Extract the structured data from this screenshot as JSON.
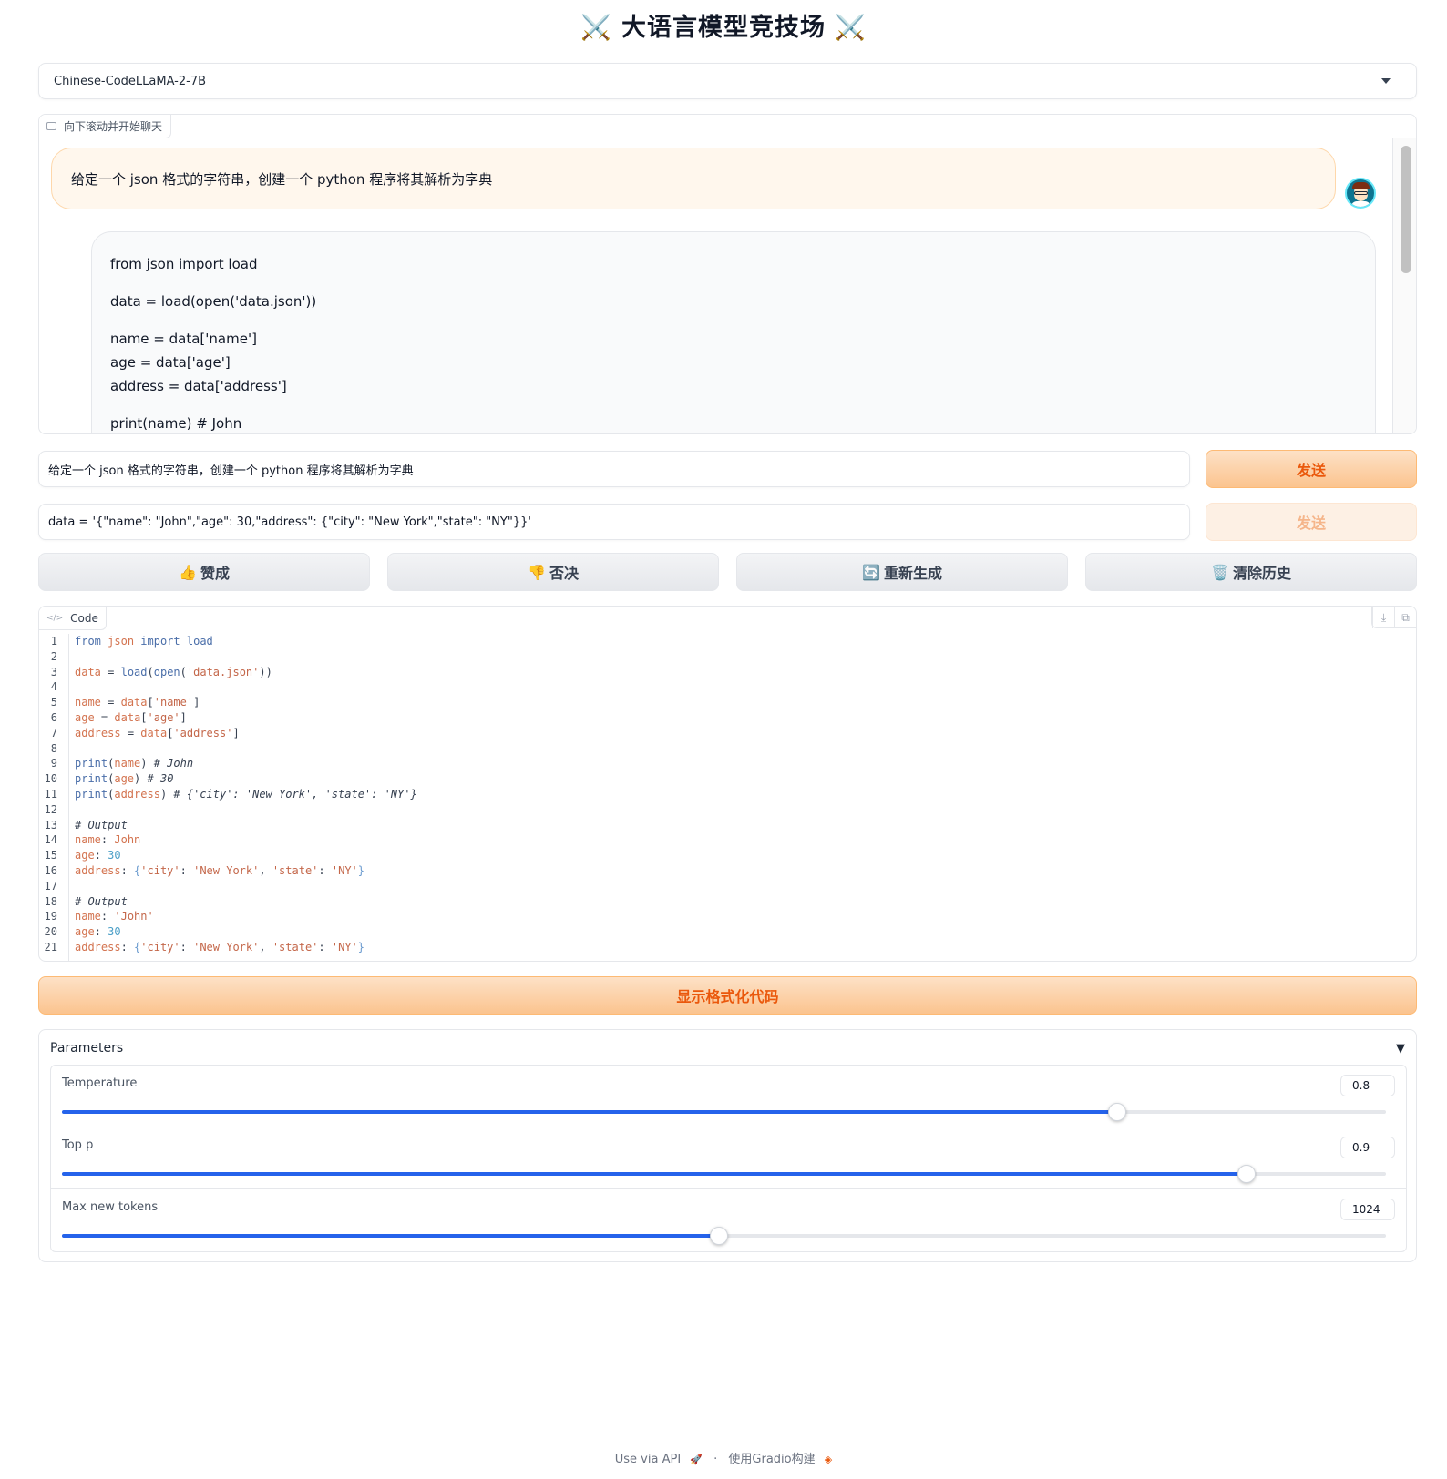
{
  "header": {
    "title": "⚔️ 大语言模型竞技场 ⚔️"
  },
  "model_select": {
    "value": "Chinese-CodeLLaMA-2-7B",
    "icon": "chevron-down-icon"
  },
  "chat": {
    "label": "向下滚动并开始聊天",
    "user_message": "给定一个 json 格式的字符串，创建一个 python 程序将其解析为字典",
    "bot_lines": [
      "from json import load",
      "data = load(open('data.json'))",
      "name = data['name']",
      "age = data['age']",
      "address = data['address']",
      "print(name) # John"
    ]
  },
  "inputs": [
    {
      "value": "给定一个 json 格式的字符串，创建一个 python 程序将其解析为字典",
      "button": "发送"
    },
    {
      "value": "data = '{\"name\": \"John\",\"age\": 30,\"address\": {\"city\": \"New York\",\"state\": \"NY\"}}'",
      "button": "发送"
    }
  ],
  "actions": [
    {
      "emoji": "👍",
      "label": "赞成"
    },
    {
      "emoji": "👎",
      "label": "否决"
    },
    {
      "emoji": "🔄",
      "label": "重新生成"
    },
    {
      "emoji": "🗑️",
      "label": "清除历史"
    }
  ],
  "code": {
    "label": "Code",
    "line_count": 21,
    "lines": [
      "from json import load",
      "",
      "data = load(open('data.json'))",
      "",
      "name = data['name']",
      "age = data['age']",
      "address = data['address']",
      "",
      "print(name) # John",
      "print(age) # 30",
      "print(address) # {'city': 'New York', 'state': 'NY'}",
      "",
      "# Output",
      "name: John",
      "age: 30",
      "address: {'city': 'New York', 'state': 'NY'}",
      "",
      "# Output",
      "name: 'John'",
      "age: 30",
      "address: {'city': 'New York', 'state': 'NY'}"
    ]
  },
  "format_button": "显示格式化代码",
  "parameters": {
    "title": "Parameters",
    "toggle": "▼",
    "sliders": [
      {
        "label": "Temperature",
        "value": "0.8",
        "fraction": 0.797
      },
      {
        "label": "Top p",
        "value": "0.9",
        "fraction": 0.895
      },
      {
        "label": "Max new tokens",
        "value": "1024",
        "fraction": 0.496
      }
    ]
  },
  "footer": {
    "api": "Use via API",
    "sep": "·",
    "built": "使用Gradio构建"
  }
}
